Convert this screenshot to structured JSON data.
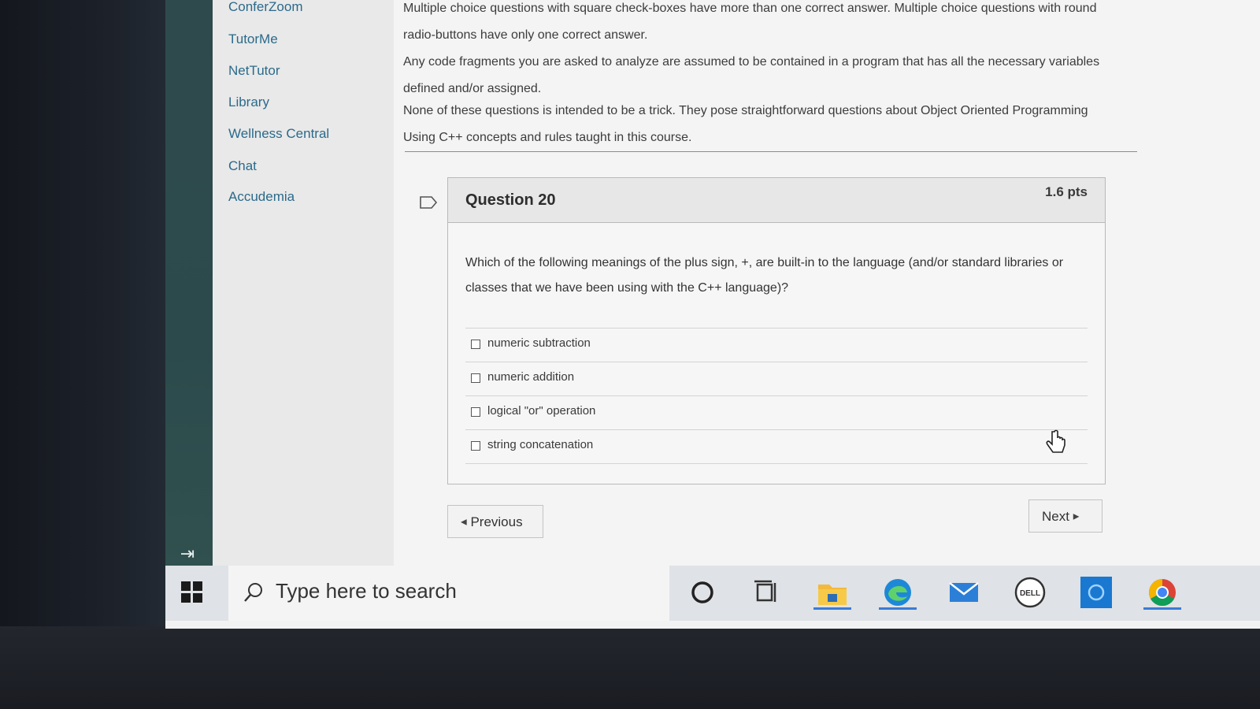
{
  "course_nav": {
    "items": [
      {
        "label": "ConferZoom"
      },
      {
        "label": "TutorMe"
      },
      {
        "label": "NetTutor"
      },
      {
        "label": "Library"
      },
      {
        "label": "Wellness Central"
      },
      {
        "label": "Chat"
      },
      {
        "label": "Accudemia"
      }
    ]
  },
  "instructions": {
    "para1": "Multiple choice questions with square check-boxes have more than one correct answer. Multiple choice questions with round radio-buttons have only one correct answer.",
    "para2": "Any code fragments you are asked to analyze are assumed to be contained in a program that has all the necessary variables defined and/or assigned.",
    "para3": "None of these questions is intended to be a trick. They pose straightforward questions about Object Oriented Programming Using C++ concepts and rules taught in this course."
  },
  "question": {
    "title": "Question 20",
    "points": "1.6 pts",
    "text": "Which of the following meanings of the plus sign, +, are built-in to the language (and/or standard libraries or classes that we have been using with the C++ language)?",
    "answers": [
      {
        "label": "numeric subtraction",
        "checked": false
      },
      {
        "label": "numeric addition",
        "checked": false
      },
      {
        "label": "logical \"or\" operation",
        "checked": false
      },
      {
        "label": "string concatenation",
        "checked": false
      }
    ]
  },
  "navigation": {
    "previous_label": "Previous",
    "next_label": "Next"
  },
  "taskbar": {
    "search_placeholder": "Type here to search",
    "dell_label": "DELL",
    "icons": [
      "windows-start-icon",
      "search-icon",
      "cortana-icon",
      "task-view-icon",
      "file-explorer-icon",
      "edge-icon",
      "mail-icon",
      "dell-icon",
      "app-icon",
      "chrome-icon"
    ]
  },
  "colors": {
    "link": "#2b6a8a",
    "global_nav": "#2f4a4d",
    "taskbar_active": "#3a7bd5"
  }
}
